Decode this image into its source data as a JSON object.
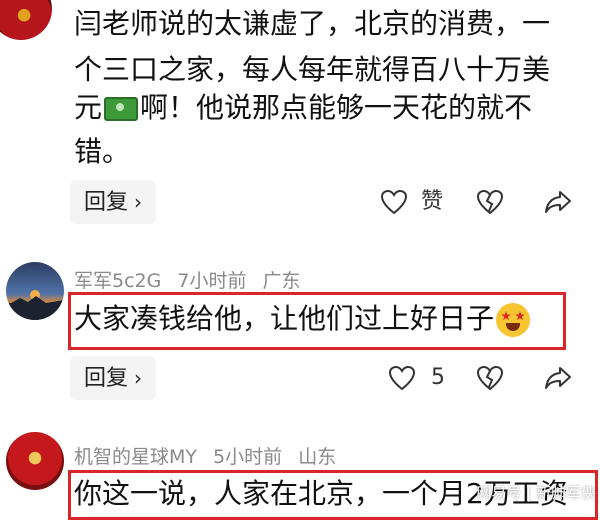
{
  "comment1": {
    "lines": [
      "闫老师说的太谦虚了，北京的消费，一",
      "个三口之家，每人每年就得百八十万美",
      "元",
      "啊！他说那点能够一天花的就不",
      "错。"
    ],
    "reply_label": "回复",
    "like_label": "赞"
  },
  "comment2": {
    "username": "军军5c2G",
    "time": "7小时前",
    "location": "广东",
    "text": "大家凑钱给他，让他们过上好日子",
    "reply_label": "回复",
    "like_count": "5"
  },
  "comment3": {
    "username": "机智的星球MY",
    "time": "5小时前",
    "location": "山东",
    "text": "你这一说，人家在北京，一个月2万工资"
  },
  "watermark": "网易号 | 新帅军侠",
  "icons": {
    "money": "money-banknote-icon",
    "emoji": "star-eyes-emoji-icon",
    "heart": "heart-icon",
    "broken_heart": "broken-heart-icon",
    "share": "share-arrow-icon",
    "chevron": "chevron-right-icon"
  },
  "colors": {
    "highlight_box": "#d9262b",
    "meta_text": "#8a8a8a",
    "reply_bg": "#f4f4f4"
  }
}
